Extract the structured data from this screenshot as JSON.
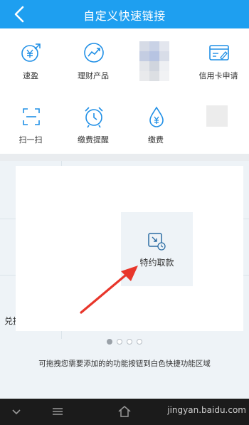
{
  "header": {
    "title": "自定义快速链接",
    "back_icon": "back-arrow-icon"
  },
  "shortcuts": [
    {
      "label": "速盈",
      "icon": "yen-exchange-icon"
    },
    {
      "label": "理财产品",
      "icon": "trend-chart-icon"
    },
    {
      "label": "",
      "icon": "blurred-placeholder-icon"
    },
    {
      "label": "信用卡申请",
      "icon": "credit-card-edit-icon"
    },
    {
      "label": "扫一扫",
      "icon": "scan-icon"
    },
    {
      "label": "缴费提醒",
      "icon": "alarm-clock-icon"
    },
    {
      "label": "缴费",
      "icon": "water-drop-yen-icon"
    },
    {
      "label": "",
      "icon": "empty-slot-icon"
    }
  ],
  "drag_tile": {
    "label": "特约取款",
    "icon": "withdraw-clock-icon"
  },
  "partial_label": "兑换",
  "pager": {
    "total": 4,
    "active": 1
  },
  "hint": "可拖拽您需要添加的的功能按钮到白色快捷功能区域",
  "watermark": "jingyan.baidu.com",
  "colors": {
    "header_bg": "#1e9ff0",
    "icon_blue": "#1f8fe6",
    "arrow_red": "#e8362b",
    "navbar_bg": "#1b1b1b"
  }
}
